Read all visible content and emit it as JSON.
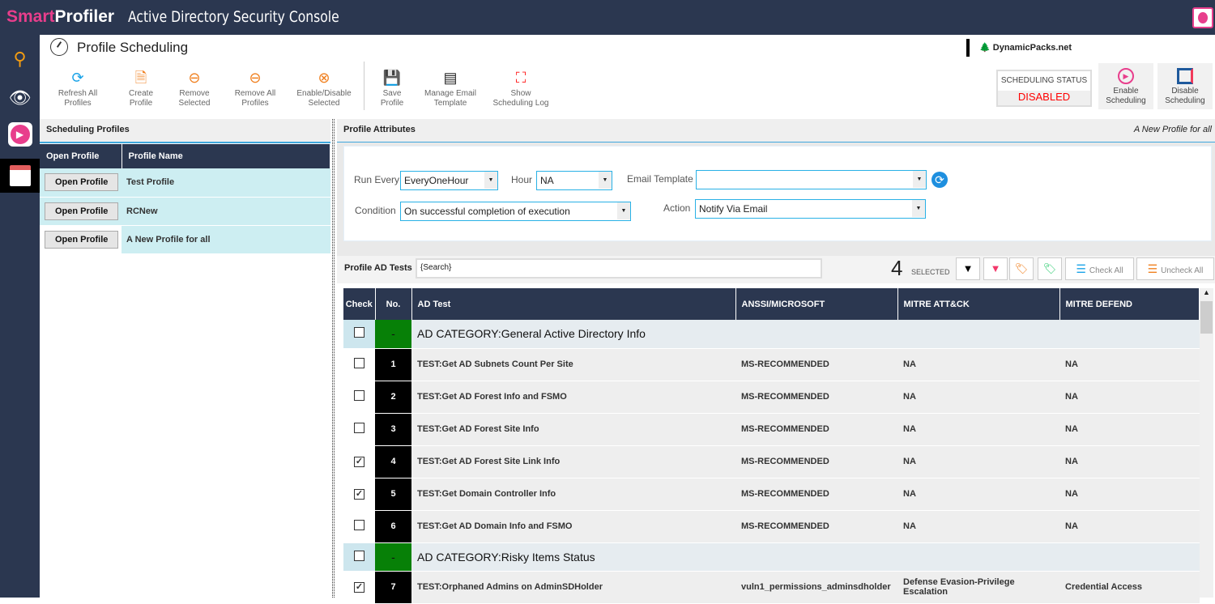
{
  "app": {
    "brand_a": "Smart",
    "brand_b": "Profiler",
    "title": "Active Directory Security Console"
  },
  "page": {
    "title": "Profile Scheduling",
    "vendor": "DynamicPacks.net"
  },
  "toolbar": [
    {
      "l1": "Refresh All",
      "l2": "Profiles",
      "icon": "refresh-icon",
      "color": "#1aa3e8",
      "glyph": "⟳"
    },
    {
      "l1": "Create",
      "l2": "Profile",
      "icon": "create-profile-icon",
      "color": "#f08020",
      "glyph": "🗎"
    },
    {
      "l1": "Remove",
      "l2": "Selected",
      "icon": "remove-user-icon",
      "color": "#f08020",
      "glyph": "⊖"
    },
    {
      "l1": "Remove All",
      "l2": "Profiles",
      "icon": "remove-all-users-icon",
      "color": "#f08020",
      "glyph": "⊖"
    },
    {
      "l1": "Enable/Disable",
      "l2": "Selected",
      "icon": "toggle-user-icon",
      "color": "#f08020",
      "glyph": "⊗"
    },
    {
      "l1": "Save",
      "l2": "Profile",
      "icon": "save-icon",
      "color": "#1e8fdf",
      "glyph": "💾"
    },
    {
      "l1": "Manage Email",
      "l2": "Template",
      "icon": "template-icon",
      "color": "#222",
      "glyph": "▤"
    },
    {
      "l1": "Show",
      "l2": "Scheduling Log",
      "icon": "log-frame-icon",
      "color": "#f22",
      "glyph": "⛶"
    }
  ],
  "scheduling": {
    "status_label": "SCHEDULING STATUS",
    "status_value": "DISABLED",
    "status_color": "#ff0000",
    "enable_l1": "Enable",
    "enable_l2": "Scheduling",
    "disable_l1": "Disable",
    "disable_l2": "Scheduling"
  },
  "profiles": {
    "header": "Scheduling Profiles",
    "col1": "Open Profile",
    "col2": "Profile Name",
    "button": "Open Profile",
    "rows": [
      "Test Profile",
      "RCNew",
      "A New Profile for all"
    ]
  },
  "attributes": {
    "header": "Profile Attributes",
    "current_profile": "A New Profile for all",
    "run_every_label": "Run Every",
    "run_every": "EveryOneHour",
    "hour_label": "Hour",
    "hour": "NA",
    "email_template_label": "Email Template",
    "email_template": "",
    "condition_label": "Condition",
    "condition": "On successful completion of execution",
    "action_label": "Action",
    "action": "Notify Via Email"
  },
  "tests": {
    "label": "Profile AD Tests",
    "search_placeholder": "{Search}",
    "selected_count": "4",
    "selected_label": "SELECTED",
    "check_all": "Check All",
    "uncheck_all": "Uncheck All",
    "columns": [
      "Check",
      "No.",
      "AD Test",
      "ANSSI/MICROSOFT",
      "MITRE ATT&CK",
      "MITRE DEFEND"
    ],
    "rows": [
      {
        "type": "cat",
        "checked": false,
        "no": "-",
        "test": "AD CATEGORY:General Active Directory Info",
        "anssi": "",
        "attack": "",
        "defend": ""
      },
      {
        "type": "test",
        "checked": false,
        "no": "1",
        "test": "TEST:Get AD Subnets Count Per Site",
        "anssi": "MS-RECOMMENDED",
        "attack": "NA",
        "defend": "NA"
      },
      {
        "type": "test",
        "checked": false,
        "no": "2",
        "test": "TEST:Get AD Forest Info and FSMO",
        "anssi": "MS-RECOMMENDED",
        "attack": "NA",
        "defend": "NA"
      },
      {
        "type": "test",
        "checked": false,
        "no": "3",
        "test": "TEST:Get AD Forest Site Info",
        "anssi": "MS-RECOMMENDED",
        "attack": "NA",
        "defend": "NA"
      },
      {
        "type": "test",
        "checked": true,
        "no": "4",
        "test": "TEST:Get AD Forest Site Link Info",
        "anssi": "MS-RECOMMENDED",
        "attack": "NA",
        "defend": "NA"
      },
      {
        "type": "test",
        "checked": true,
        "no": "5",
        "test": "TEST:Get Domain Controller Info",
        "anssi": "MS-RECOMMENDED",
        "attack": "NA",
        "defend": "NA"
      },
      {
        "type": "test",
        "checked": false,
        "no": "6",
        "test": "TEST:Get AD Domain Info and FSMO",
        "anssi": "MS-RECOMMENDED",
        "attack": "NA",
        "defend": "NA"
      },
      {
        "type": "cat",
        "checked": false,
        "no": "-",
        "test": "AD CATEGORY:Risky Items Status",
        "anssi": "",
        "attack": "",
        "defend": ""
      },
      {
        "type": "test",
        "checked": true,
        "no": "7",
        "test": "TEST:Orphaned Admins on AdminSDHolder",
        "anssi": "vuln1_permissions_adminsdholder",
        "attack": "Defense Evasion-Privilege Escalation",
        "defend": "Credential Access"
      }
    ]
  }
}
